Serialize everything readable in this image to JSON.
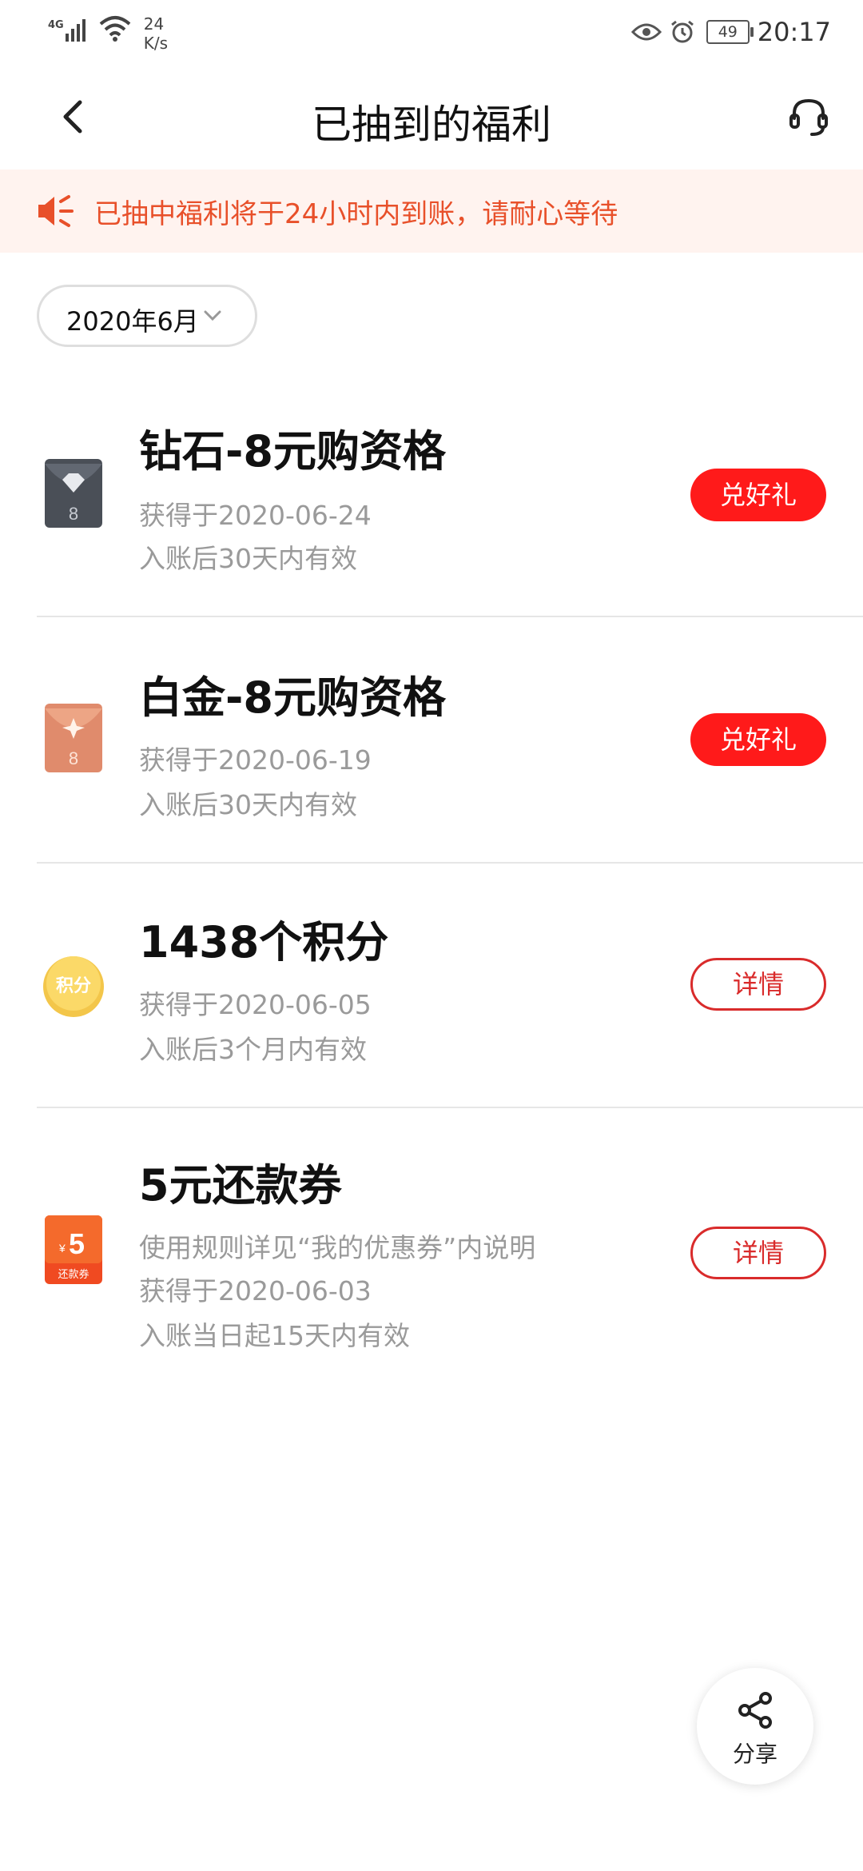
{
  "status_bar": {
    "network": "4G",
    "speed_value": "24",
    "speed_unit": "K/s",
    "battery": "49",
    "time": "20:17"
  },
  "header": {
    "title": "已抽到的福利",
    "back_icon": "chevron-left-icon",
    "service_icon": "headset-icon"
  },
  "notice": {
    "icon": "megaphone-icon",
    "text": "已抽中福利将于24小时内到账，请耐心等待",
    "color": "#e8502a",
    "background": "#fff3ef"
  },
  "filter": {
    "month": "2020年6月",
    "icon": "chevron-down-icon"
  },
  "rewards": [
    {
      "icon": "diamond-card-icon",
      "title": "钻石-8元购资格",
      "lines": [
        "获得于2020-06-24",
        "入账后30天内有效"
      ],
      "button": "兑好礼",
      "button_style": "solid"
    },
    {
      "icon": "platinum-card-icon",
      "title": "白金-8元购资格",
      "lines": [
        "获得于2020-06-19",
        "入账后30天内有效"
      ],
      "button": "兑好礼",
      "button_style": "solid"
    },
    {
      "icon": "points-coin-icon",
      "icon_text": "积分",
      "title": "1438个积分",
      "lines": [
        "获得于2020-06-05",
        "入账后3个月内有效"
      ],
      "button": "详情",
      "button_style": "outline"
    },
    {
      "icon": "repayment-coupon-icon",
      "icon_value": "5",
      "icon_currency": "¥",
      "icon_text": "还款券",
      "title": "5元还款券",
      "lines": [
        "使用规则详见“我的优惠券”内说明",
        "获得于2020-06-03",
        "入账当日起15天内有效"
      ],
      "button": "详情",
      "button_style": "outline"
    }
  ],
  "share": {
    "icon": "share-icon",
    "label": "分享"
  },
  "colors": {
    "accent_red": "#ff1a1a",
    "outline_red": "#d92b2b",
    "muted_text": "#9a9a9a"
  }
}
